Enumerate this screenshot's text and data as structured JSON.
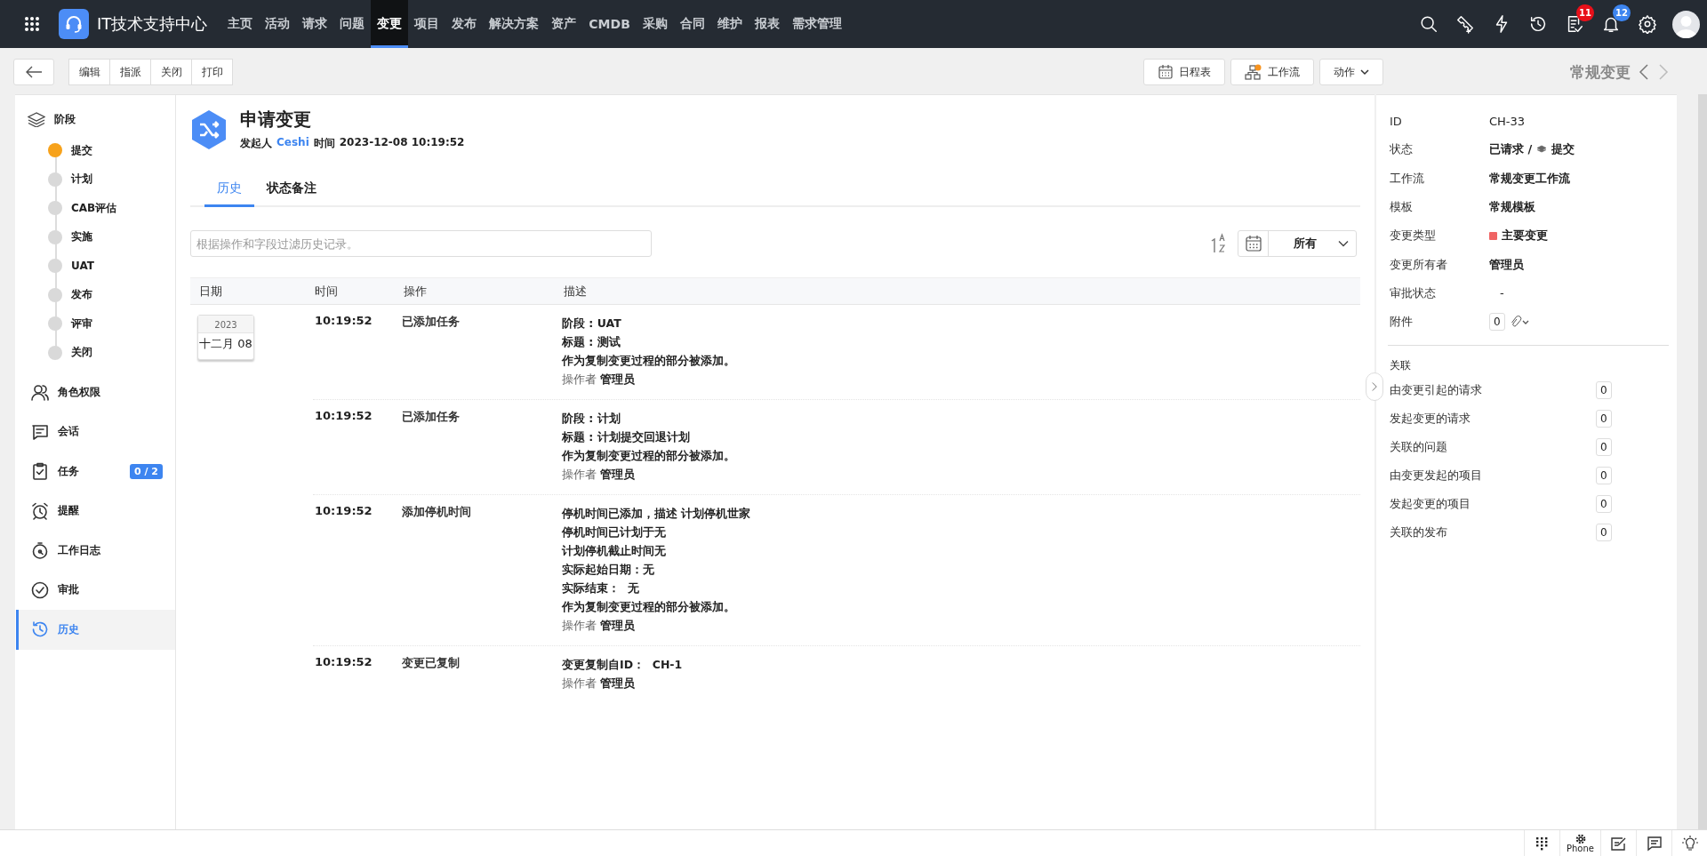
{
  "topbar": {
    "brand": "IT技术支持中心",
    "nav_items": [
      {
        "label": "主页",
        "selected": false
      },
      {
        "label": "活动",
        "selected": false
      },
      {
        "label": "请求",
        "selected": false
      },
      {
        "label": "问题",
        "selected": false
      },
      {
        "label": "变更",
        "selected": true
      },
      {
        "label": "项目",
        "selected": false
      },
      {
        "label": "发布",
        "selected": false
      },
      {
        "label": "解决方案",
        "selected": false
      },
      {
        "label": "资产",
        "selected": false
      },
      {
        "label": "CMDB",
        "selected": false
      },
      {
        "label": "采购",
        "selected": false
      },
      {
        "label": "合同",
        "selected": false
      },
      {
        "label": "维护",
        "selected": false
      },
      {
        "label": "报表",
        "selected": false
      },
      {
        "label": "需求管理",
        "selected": false
      }
    ],
    "tasks_badge": "11",
    "notifications_badge": "12"
  },
  "toolbar": {
    "buttons": [
      "编辑",
      "指派",
      "关闭",
      "打印"
    ],
    "calendar_button": "日程表",
    "workflow_button": "工作流",
    "actions_button": "动作",
    "record_type": "常规变更"
  },
  "sidebar": {
    "stages_title": "阶段",
    "stages": [
      {
        "label": "提交",
        "current": true
      },
      {
        "label": "计划",
        "current": false
      },
      {
        "label": "CAB评估",
        "current": false
      },
      {
        "label": "实施",
        "current": false
      },
      {
        "label": "UAT",
        "current": false
      },
      {
        "label": "发布",
        "current": false
      },
      {
        "label": "评审",
        "current": false
      },
      {
        "label": "关闭",
        "current": false
      }
    ],
    "items": [
      {
        "label": "角色权限",
        "selected": false
      },
      {
        "label": "会话",
        "selected": false
      },
      {
        "label": "任务",
        "selected": false,
        "badge": "0 / 2"
      },
      {
        "label": "提醒",
        "selected": false
      },
      {
        "label": "工作日志",
        "selected": false
      },
      {
        "label": "审批",
        "selected": false
      },
      {
        "label": "历史",
        "selected": true
      }
    ]
  },
  "header": {
    "title": "申请变更",
    "requester_label": "发起人",
    "requester": "Ceshi",
    "time_label": "时间",
    "time": "2023-12-08 10:19:52"
  },
  "tabs": [
    {
      "label": "历史",
      "selected": true
    },
    {
      "label": "状态备注",
      "selected": false
    }
  ],
  "filter": {
    "placeholder": "根据操作和字段过滤历史记录。"
  },
  "date_filter": {
    "value": "所有"
  },
  "history": {
    "columns": [
      "日期",
      "时间",
      "操作",
      "描述"
    ],
    "date": {
      "year": "2023",
      "day": "十二月 08"
    },
    "rows": [
      {
        "time": "10:19:52",
        "action": "已添加任务",
        "description": [
          "阶段 : UAT",
          "标题 : 测试",
          "作为复制变更过程的部分被添加。"
        ],
        "operator_label": "操作者",
        "operator": "管理员"
      },
      {
        "time": "10:19:52",
        "action": "已添加任务",
        "description": [
          "阶段 : 计划",
          "标题 : 计划提交回退计划",
          "作为复制变更过程的部分被添加。"
        ],
        "operator_label": "操作者",
        "operator": "管理员"
      },
      {
        "time": "10:19:52",
        "action": "添加停机时间",
        "description": [
          "停机时间已添加，描述 计划停机世家",
          "停机时间已计划于无",
          "计划停机截止时间无",
          "实际起始日期：无",
          "实际结束：  无",
          "作为复制变更过程的部分被添加。"
        ],
        "operator_label": "操作者",
        "operator": "管理员"
      },
      {
        "time": "10:19:52",
        "action": "变更已复制",
        "description": [
          "变更复制自ID：  CH-1"
        ],
        "operator_label": "操作者",
        "operator": "管理员"
      }
    ]
  },
  "details": {
    "fields": [
      {
        "kind": "text",
        "label": "ID",
        "value": "CH-33"
      },
      {
        "kind": "status",
        "label": "状态",
        "value": "已请求 /",
        "stage": "提交"
      },
      {
        "kind": "text",
        "label": "工作流",
        "value": "常规变更工作流"
      },
      {
        "kind": "text",
        "label": "模板",
        "value": "常规模板"
      },
      {
        "kind": "tag",
        "label": "变更类型",
        "value": "主要变更",
        "color": "#f06464"
      },
      {
        "kind": "text",
        "label": "变更所有者",
        "value": "管理员"
      },
      {
        "kind": "dash",
        "label": "审批状态",
        "value": "-"
      },
      {
        "kind": "attachment",
        "label": "附件",
        "value": "0"
      }
    ],
    "related_title": "关联",
    "related": [
      {
        "label": "由变更引起的请求",
        "count": "0"
      },
      {
        "label": "发起变更的请求",
        "count": "0"
      },
      {
        "label": "关联的问题",
        "count": "0"
      },
      {
        "label": "由变更发起的项目",
        "count": "0"
      },
      {
        "label": "发起变更的项目",
        "count": "0"
      },
      {
        "label": "关联的发布",
        "count": "0"
      }
    ]
  },
  "bottombar": {
    "phone_label": "Phone"
  }
}
